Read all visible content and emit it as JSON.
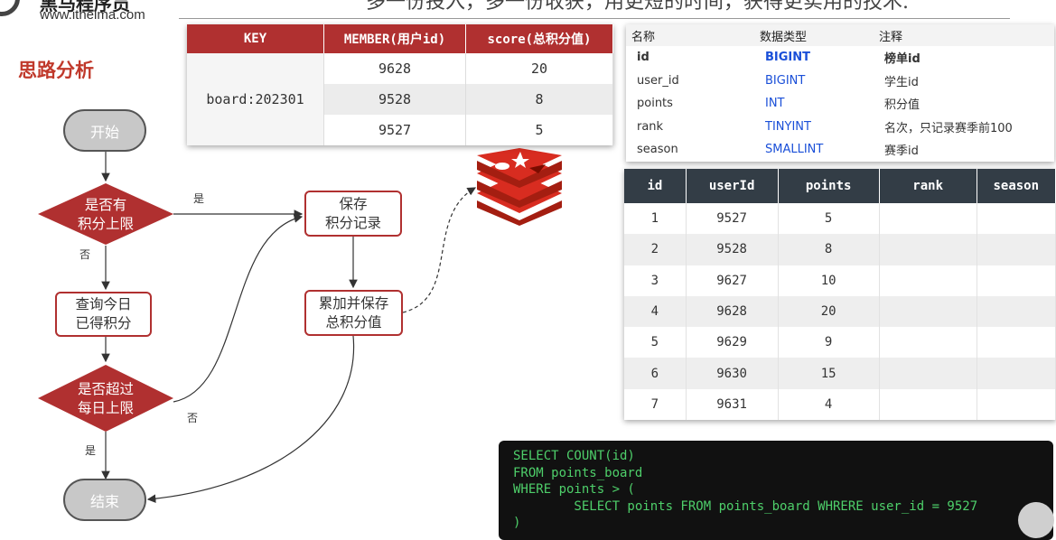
{
  "header": {
    "brand_name": "黑马程序员",
    "brand_site": "www.itheima.com",
    "slogan": "多一份投入，多一份收获，用更短的时间，获得更实用的技术."
  },
  "section_title": "思路分析",
  "flow": {
    "start": "开始",
    "decision1_line1": "是否有",
    "decision1_line2": "积分上限",
    "yes1": "是",
    "no1": "否",
    "query_line1": "查询今日",
    "query_line2": "已得积分",
    "decision2_line1": "是否超过",
    "decision2_line2": "每日上限",
    "no2": "否",
    "yes2": "是",
    "end": "结束",
    "save_line1": "保存",
    "save_line2": "积分记录",
    "accum_line1": "累加并保存",
    "accum_line2": "总积分值"
  },
  "redis_table": {
    "headers": [
      "KEY",
      "MEMBER(用户id)",
      "score(总积分值)"
    ],
    "key": "board:202301",
    "rows": [
      {
        "member": "9628",
        "score": "20"
      },
      {
        "member": "9528",
        "score": "8"
      },
      {
        "member": "9527",
        "score": "5"
      }
    ]
  },
  "schema": {
    "headers": [
      "名称",
      "数据类型",
      "注释"
    ],
    "rows": [
      {
        "name": "id",
        "type": "BIGINT",
        "comment": "榜单id"
      },
      {
        "name": "user_id",
        "type": "BIGINT",
        "comment": "学生id"
      },
      {
        "name": "points",
        "type": "INT",
        "comment": "积分值"
      },
      {
        "name": "rank",
        "type": "TINYINT",
        "comment": "名次，只记录赛季前100"
      },
      {
        "name": "season",
        "type": "SMALLINT",
        "comment": "赛季id"
      }
    ]
  },
  "data_table": {
    "headers": [
      "id",
      "userId",
      "points",
      "rank",
      "season"
    ],
    "rows": [
      {
        "id": "1",
        "userId": "9527",
        "points": "5"
      },
      {
        "id": "2",
        "userId": "9528",
        "points": "8"
      },
      {
        "id": "3",
        "userId": "9627",
        "points": "10"
      },
      {
        "id": "4",
        "userId": "9628",
        "points": "20"
      },
      {
        "id": "5",
        "userId": "9629",
        "points": "9"
      },
      {
        "id": "6",
        "userId": "9630",
        "points": "15"
      },
      {
        "id": "7",
        "userId": "9631",
        "points": "4"
      }
    ]
  },
  "code": {
    "line1": "SELECT COUNT(id)",
    "line2": "FROM points_board",
    "line3": "WHERE points > (",
    "line4": "        SELECT points FROM points_board WHRERE user_id = 9527",
    "line5": ")"
  },
  "colors": {
    "accent_red": "#b03030",
    "title_red": "#c0392b",
    "table_header_dark": "#333d46",
    "code_green": "#4ecf6a",
    "type_blue": "#1a4fd8"
  },
  "icons": {
    "redis": "redis-logo-icon",
    "logo": "itheima-logo-icon"
  }
}
